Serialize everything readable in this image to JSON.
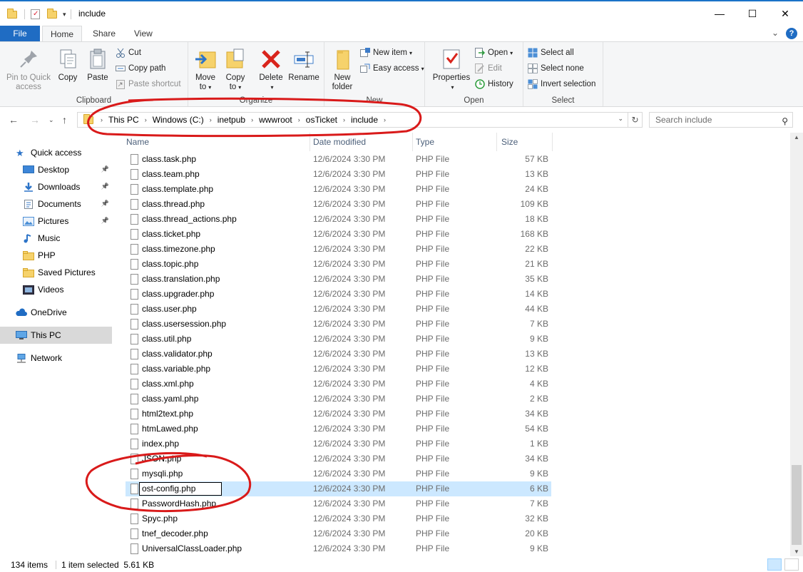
{
  "window": {
    "title": "include",
    "controls": {
      "minimize": "—",
      "maximize": "☐",
      "close": "✕"
    }
  },
  "ribbon_tabs": [
    "File",
    "Home",
    "Share",
    "View"
  ],
  "ribbon": {
    "clipboard": {
      "label": "Clipboard",
      "pin": "Pin to Quick access",
      "pin_line1": "Pin to Quick",
      "pin_line2": "access",
      "copy": "Copy",
      "paste": "Paste",
      "cut": "Cut",
      "copy_path": "Copy path",
      "paste_shortcut": "Paste shortcut"
    },
    "organize": {
      "label": "Organize",
      "move_to": "Move",
      "move_to2": "to",
      "copy_to": "Copy",
      "copy_to2": "to",
      "delete": "Delete",
      "rename": "Rename"
    },
    "new": {
      "label": "New",
      "new_folder1": "New",
      "new_folder2": "folder",
      "new_item": "New item",
      "easy_access": "Easy access"
    },
    "open": {
      "label": "Open",
      "properties": "Properties",
      "open": "Open",
      "edit": "Edit",
      "history": "History"
    },
    "select": {
      "label": "Select",
      "select_all": "Select all",
      "select_none": "Select none",
      "invert": "Invert selection"
    }
  },
  "address": {
    "breadcrumbs": [
      "This PC",
      "Windows (C:)",
      "inetpub",
      "wwwroot",
      "osTicket",
      "include"
    ],
    "search_placeholder": "Search include"
  },
  "nav": {
    "quick_access": "Quick access",
    "items": [
      {
        "label": "Desktop",
        "pinned": true
      },
      {
        "label": "Downloads",
        "pinned": true
      },
      {
        "label": "Documents",
        "pinned": true
      },
      {
        "label": "Pictures",
        "pinned": true
      },
      {
        "label": "Music",
        "pinned": false
      },
      {
        "label": "PHP",
        "pinned": false
      },
      {
        "label": "Saved Pictures",
        "pinned": false
      },
      {
        "label": "Videos",
        "pinned": false
      }
    ],
    "onedrive": "OneDrive",
    "this_pc": "This PC",
    "network": "Network"
  },
  "columns": {
    "name": "Name",
    "date": "Date modified",
    "type": "Type",
    "size": "Size"
  },
  "files": [
    {
      "name": "class.task.php",
      "date": "12/6/2024 3:30 PM",
      "type": "PHP File",
      "size": "57 KB"
    },
    {
      "name": "class.team.php",
      "date": "12/6/2024 3:30 PM",
      "type": "PHP File",
      "size": "13 KB"
    },
    {
      "name": "class.template.php",
      "date": "12/6/2024 3:30 PM",
      "type": "PHP File",
      "size": "24 KB"
    },
    {
      "name": "class.thread.php",
      "date": "12/6/2024 3:30 PM",
      "type": "PHP File",
      "size": "109 KB"
    },
    {
      "name": "class.thread_actions.php",
      "date": "12/6/2024 3:30 PM",
      "type": "PHP File",
      "size": "18 KB"
    },
    {
      "name": "class.ticket.php",
      "date": "12/6/2024 3:30 PM",
      "type": "PHP File",
      "size": "168 KB"
    },
    {
      "name": "class.timezone.php",
      "date": "12/6/2024 3:30 PM",
      "type": "PHP File",
      "size": "22 KB"
    },
    {
      "name": "class.topic.php",
      "date": "12/6/2024 3:30 PM",
      "type": "PHP File",
      "size": "21 KB"
    },
    {
      "name": "class.translation.php",
      "date": "12/6/2024 3:30 PM",
      "type": "PHP File",
      "size": "35 KB"
    },
    {
      "name": "class.upgrader.php",
      "date": "12/6/2024 3:30 PM",
      "type": "PHP File",
      "size": "14 KB"
    },
    {
      "name": "class.user.php",
      "date": "12/6/2024 3:30 PM",
      "type": "PHP File",
      "size": "44 KB"
    },
    {
      "name": "class.usersession.php",
      "date": "12/6/2024 3:30 PM",
      "type": "PHP File",
      "size": "7 KB"
    },
    {
      "name": "class.util.php",
      "date": "12/6/2024 3:30 PM",
      "type": "PHP File",
      "size": "9 KB"
    },
    {
      "name": "class.validator.php",
      "date": "12/6/2024 3:30 PM",
      "type": "PHP File",
      "size": "13 KB"
    },
    {
      "name": "class.variable.php",
      "date": "12/6/2024 3:30 PM",
      "type": "PHP File",
      "size": "12 KB"
    },
    {
      "name": "class.xml.php",
      "date": "12/6/2024 3:30 PM",
      "type": "PHP File",
      "size": "4 KB"
    },
    {
      "name": "class.yaml.php",
      "date": "12/6/2024 3:30 PM",
      "type": "PHP File",
      "size": "2 KB"
    },
    {
      "name": "html2text.php",
      "date": "12/6/2024 3:30 PM",
      "type": "PHP File",
      "size": "34 KB"
    },
    {
      "name": "htmLawed.php",
      "date": "12/6/2024 3:30 PM",
      "type": "PHP File",
      "size": "54 KB"
    },
    {
      "name": "index.php",
      "date": "12/6/2024 3:30 PM",
      "type": "PHP File",
      "size": "1 KB"
    },
    {
      "name": "JSON.php",
      "date": "12/6/2024 3:30 PM",
      "type": "PHP File",
      "size": "34 KB"
    },
    {
      "name": "mysqli.php",
      "date": "12/6/2024 3:30 PM",
      "type": "PHP File",
      "size": "9 KB"
    },
    {
      "name": "ost-config.php",
      "date": "12/6/2024 3:30 PM",
      "type": "PHP File",
      "size": "6 KB",
      "selected": true,
      "renaming": true
    },
    {
      "name": "PasswordHash.php",
      "date": "12/6/2024 3:30 PM",
      "type": "PHP File",
      "size": "7 KB"
    },
    {
      "name": "Spyc.php",
      "date": "12/6/2024 3:30 PM",
      "type": "PHP File",
      "size": "32 KB"
    },
    {
      "name": "tnef_decoder.php",
      "date": "12/6/2024 3:30 PM",
      "type": "PHP File",
      "size": "20 KB"
    },
    {
      "name": "UniversalClassLoader.php",
      "date": "12/6/2024 3:30 PM",
      "type": "PHP File",
      "size": "9 KB"
    }
  ],
  "status": {
    "item_count": "134 items",
    "selection": "1 item selected  5.61 KB"
  },
  "colors": {
    "accent": "#1f6cc3",
    "selection": "#cce8ff",
    "annotation": "#d91a1a"
  }
}
